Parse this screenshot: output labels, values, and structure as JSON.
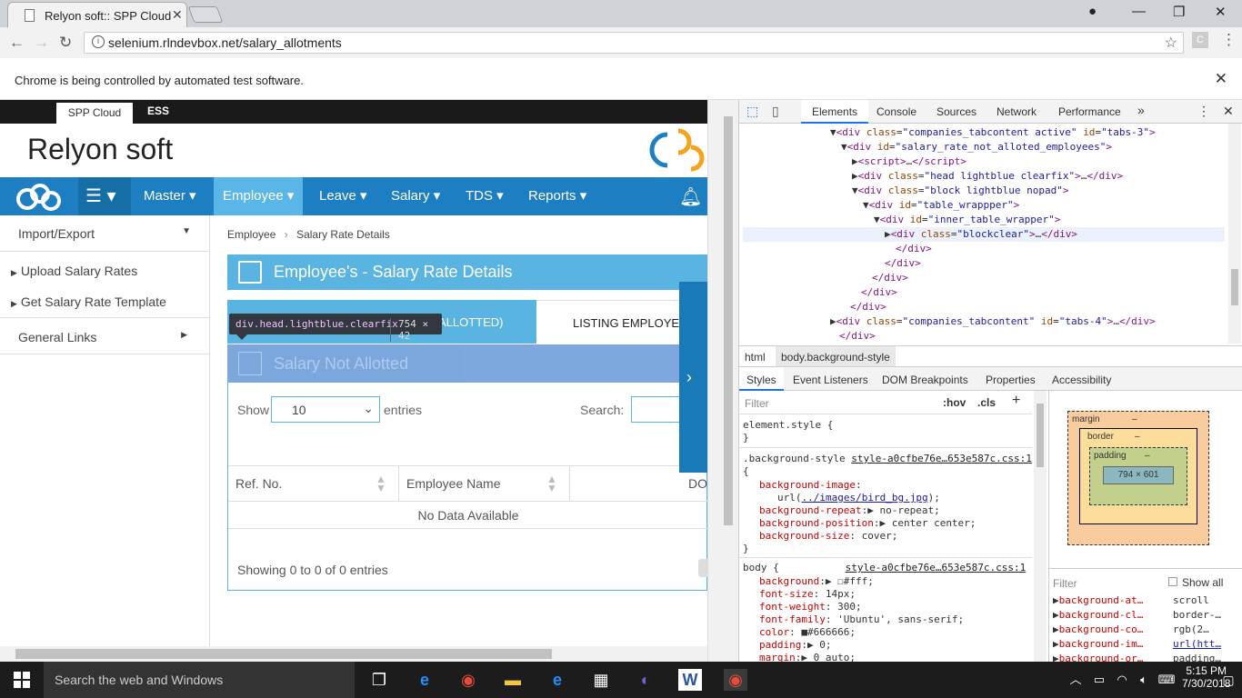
{
  "browser": {
    "tab_title": "Relyon soft:: SPP Cloud",
    "url": "selenium.rlndevbox.net/salary_allotments",
    "infobar_text": "Chrome is being controlled by automated test software."
  },
  "app": {
    "top_tabs": [
      "SPP Cloud",
      "ESS"
    ],
    "brand": "Relyon soft",
    "nav_items": [
      "Master",
      "Employee",
      "Leave",
      "Salary",
      "TDS",
      "Reports"
    ],
    "active_nav": "Employee",
    "sidebar": {
      "section1": "Import/Export",
      "items": [
        "Upload Salary Rates",
        "Get Salary Rate Template"
      ],
      "section2": "General Links"
    },
    "breadcrumb": [
      "Employee",
      "Salary Rate Details"
    ],
    "panel_title": "Employee's - Salary Rate Details",
    "tab1_label": "ALLOTTED)",
    "tab2_label": "LISTING EMPLOYEE (",
    "subpanel_title": "Salary Not Allotted",
    "show_label": "Show",
    "entries_value": "10",
    "entries_label": "entries",
    "search_label": "Search:",
    "columns": [
      "Ref. No.",
      "Employee Name",
      "DO"
    ],
    "no_data": "No Data Available",
    "showing": "Showing 0 to 0 of 0 entries"
  },
  "tooltip": {
    "selector": "div.head.lightblue.clearfix",
    "size": "754 × 42"
  },
  "devtools": {
    "tabs": [
      "Elements",
      "Console",
      "Sources",
      "Network",
      "Performance",
      "»"
    ],
    "breadcrumbs": [
      "html",
      "body.background-style"
    ],
    "subtabs": [
      "Styles",
      "Event Listeners",
      "DOM Breakpoints",
      "Properties",
      "Accessibility"
    ],
    "filter_placeholder": "Filter",
    "hov": ":hov",
    "cls": ".cls",
    "boxmodel": {
      "margin": "margin",
      "border": "border",
      "padding": "padding",
      "content": "794 × 601",
      "dash": "–"
    },
    "computed_filter": "Filter",
    "show_all": "Show all",
    "computed": [
      {
        "name": "background-at…",
        "value": "scroll"
      },
      {
        "name": "background-cl…",
        "value": "border-…"
      },
      {
        "name": "background-co…",
        "value": "rgb(2…"
      },
      {
        "name": "background-im…",
        "value": "url(htt…"
      },
      {
        "name": "background-or…",
        "value": "padding…"
      }
    ]
  },
  "taskbar": {
    "search_text": "Search the web and Windows",
    "time": "5:15 PM",
    "date": "7/30/2018"
  }
}
